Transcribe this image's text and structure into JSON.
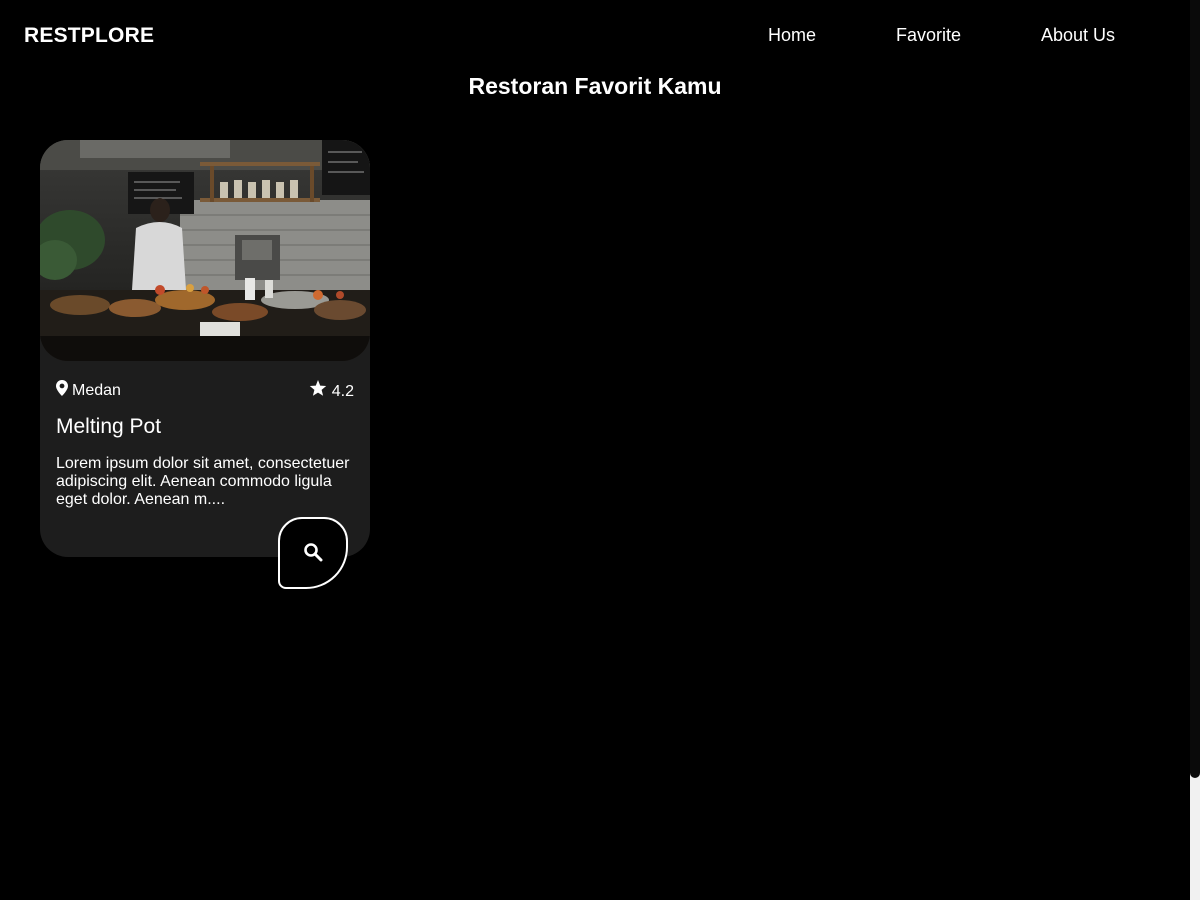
{
  "header": {
    "brand": "RESTPLORE",
    "nav": [
      {
        "label": "Home"
      },
      {
        "label": "Favorite"
      },
      {
        "label": "About Us"
      }
    ]
  },
  "main": {
    "title": "Restoran Favorit Kamu",
    "restaurants": [
      {
        "city": "Medan",
        "city_icon": "map-pin-icon",
        "rating": "4.2",
        "rating_icon": "star-icon",
        "name": "Melting Pot",
        "description": "Lorem ipsum dolor sit amet, consectetuer adipiscing elit. Aenean commodo ligula eget dolor. Aenean m....",
        "detail_icon": "search-icon"
      }
    ]
  },
  "colors": {
    "background": "#000000",
    "card": "#1d1d1d",
    "text": "#ffffff"
  }
}
